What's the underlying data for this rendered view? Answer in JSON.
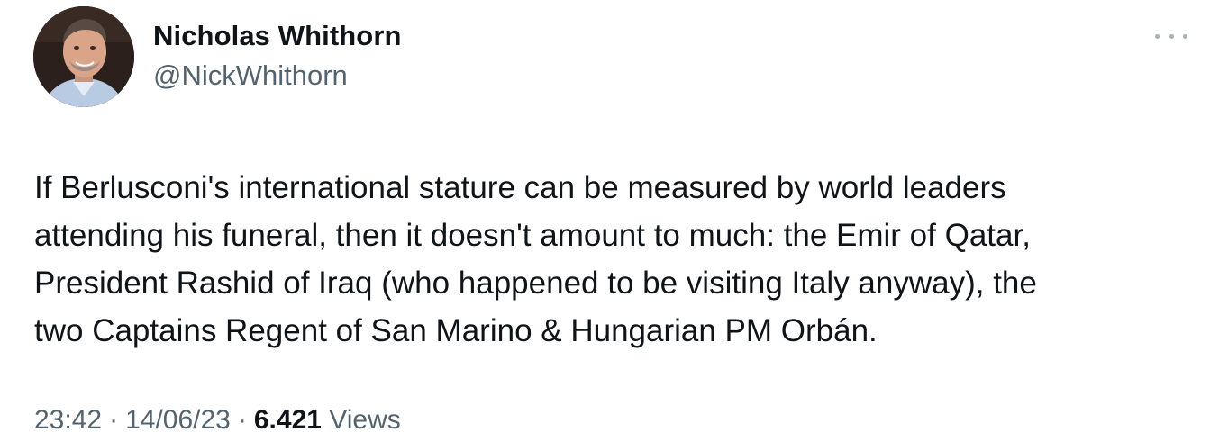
{
  "author": {
    "display_name": "Nicholas Whithorn",
    "handle": "@NickWhithorn"
  },
  "tweet": {
    "lines": [
      "If Berlusconi's international stature can be measured by world leaders",
      "attending his funeral, then it doesn't amount to much: the Emir of Qatar,",
      "President Rashid of Iraq (who happened to be visiting Italy anyway), the",
      "two Captains Regent of San Marino & Hungarian PM Orbán."
    ]
  },
  "meta": {
    "time": "23:42",
    "date": "14/06/23",
    "separator": "·",
    "views_count": "6.421",
    "views_label": "Views"
  },
  "icons": {
    "more": "more-horizontal-icon"
  },
  "colors": {
    "primary_text": "#0f1419",
    "secondary_text": "#536471",
    "more_dots": "#a7b1b9"
  }
}
